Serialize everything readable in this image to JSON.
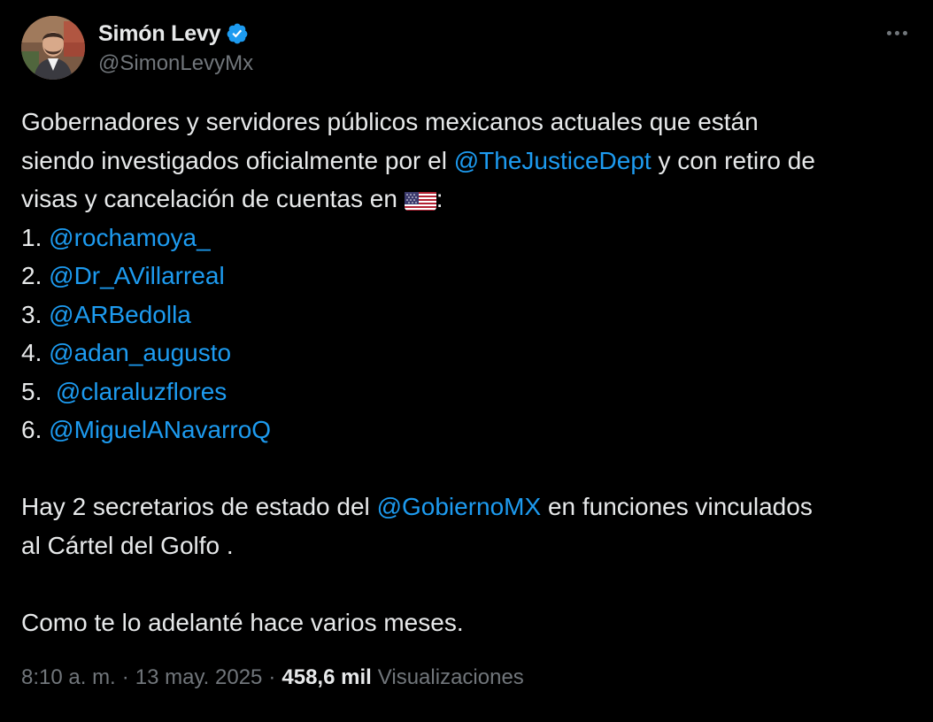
{
  "author": {
    "display_name": "Simón Levy",
    "handle": "@SimonLevyMx",
    "verified": true,
    "avatar_icon": "profile-photo"
  },
  "more_icon": "ellipsis-icon",
  "tweet": {
    "intro_line1": "Gobernadores y servidores públicos mexicanos actuales que están",
    "intro_line2_pre": "siendo investigados oficialmente por el ",
    "intro_line2_mention": "@TheJusticeDept",
    "intro_line2_post": " y con retiro de",
    "intro_line3_pre": "visas y cancelación de cuentas en ",
    "intro_line3_flag": "us-flag-emoji",
    "intro_line3_post": ":",
    "list": [
      {
        "num": "1. ",
        "mention": "@rochamoya_"
      },
      {
        "num": "2. ",
        "mention": "@Dr_AVillarreal"
      },
      {
        "num": "3. ",
        "mention": "@ARBedolla"
      },
      {
        "num": "4. ",
        "mention": "@adan_augusto"
      },
      {
        "num": "5.  ",
        "mention": "@claraluzflores"
      },
      {
        "num": "6. ",
        "mention": "@MiguelANavarroQ"
      }
    ],
    "para2_line1_pre": "Hay 2 secretarios de estado del ",
    "para2_line1_mention": "@GobiernoMX",
    "para2_line1_post": " en funciones vinculados",
    "para2_line2": "al Cártel del Golfo .",
    "para3": "Como te lo adelanté hace varios meses."
  },
  "meta": {
    "time": "8:10 a. m.",
    "separator": "·",
    "date": "13 may. 2025",
    "views_count": "458,6 mil",
    "views_label": "Visualizaciones"
  },
  "colors": {
    "background": "#000000",
    "text": "#e7e9ea",
    "secondary": "#71767b",
    "link": "#1d9bf0",
    "verified": "#1d9bf0"
  }
}
